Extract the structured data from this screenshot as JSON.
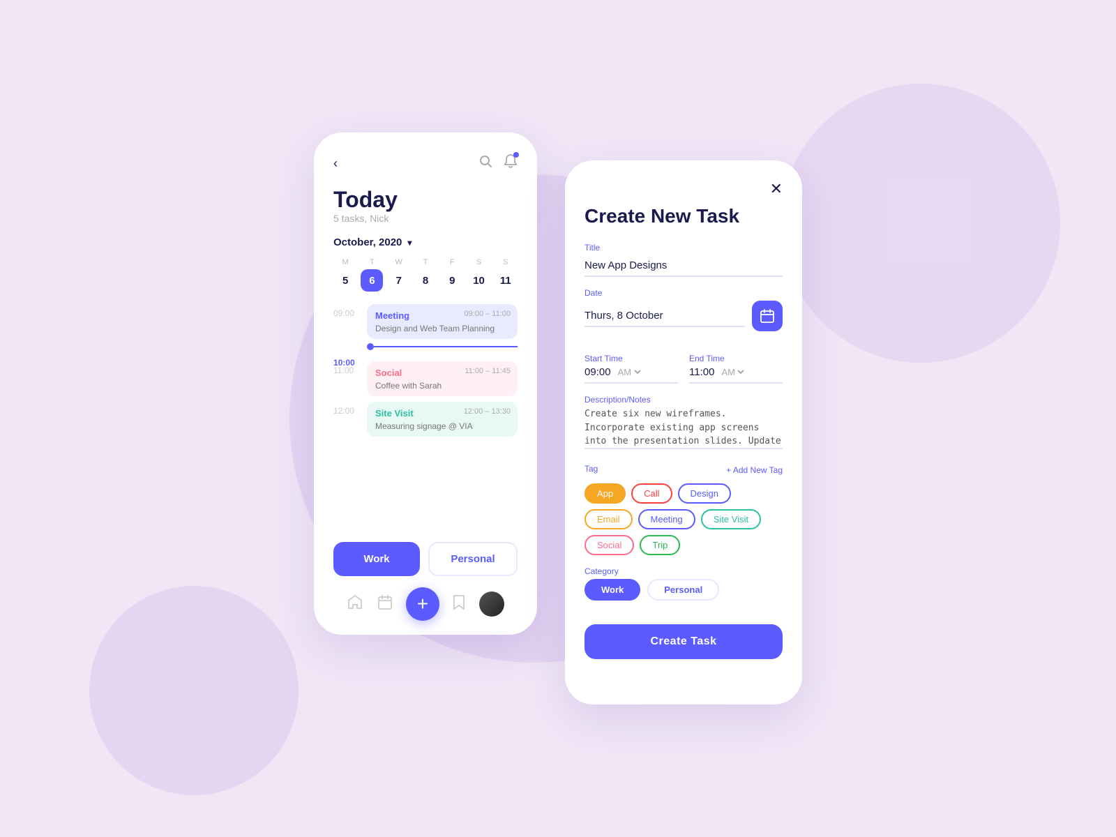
{
  "background": {
    "color": "#f0e6f6"
  },
  "phone1": {
    "header": {
      "back_label": "‹",
      "search_icon": "🔍",
      "notif_icon": "🔔"
    },
    "title": "Today",
    "subtitle": "5 tasks, Nick",
    "month": "October, 2020",
    "calendar": {
      "days": [
        {
          "letter": "M",
          "num": "5"
        },
        {
          "letter": "T",
          "num": "6",
          "active": true
        },
        {
          "letter": "W",
          "num": "7"
        },
        {
          "letter": "T",
          "num": "8"
        },
        {
          "letter": "F",
          "num": "9"
        },
        {
          "letter": "S",
          "num": "10"
        },
        {
          "letter": "S",
          "num": "11"
        }
      ]
    },
    "schedule": [
      {
        "time": "09:00",
        "event": {
          "title": "Meeting",
          "time_range": "09:00 – 11:00",
          "desc": "Design and Web Team Planning",
          "color": "blue"
        }
      },
      {
        "time": "10:00",
        "highlight": true
      },
      {
        "time": "11:00",
        "event": {
          "title": "Social",
          "time_range": "11:00 – 11:45",
          "desc": "Coffee with Sarah",
          "color": "pink"
        }
      },
      {
        "time": "12:00",
        "event": {
          "title": "Site Visit",
          "time_range": "12:00 – 13:30",
          "desc": "Measuring signage @ VIA",
          "color": "teal"
        }
      }
    ],
    "buttons": {
      "work": "Work",
      "personal": "Personal"
    },
    "nav": {
      "home_icon": "⌂",
      "calendar_icon": "📅",
      "add_icon": "+",
      "bookmark_icon": "🔖"
    }
  },
  "phone2": {
    "close_icon": "✕",
    "title": "Create New Task",
    "fields": {
      "title_label": "Title",
      "title_value": "New App Designs",
      "date_label": "Date",
      "date_value": "Thurs, 8 October",
      "start_time_label": "Start Time",
      "start_time_value": "09:00",
      "start_ampm": "AM",
      "end_time_label": "End Time",
      "end_time_value": "11:00",
      "end_ampm": "AM",
      "desc_label": "Description/Notes",
      "desc_value": "Create six new wireframes. Incorporate existing app screens into the presentation slides. Update and expand existing icons."
    },
    "tags": {
      "label": "Tag",
      "add_label": "+ Add New Tag",
      "items": [
        {
          "name": "App",
          "style": "app"
        },
        {
          "name": "Call",
          "style": "call"
        },
        {
          "name": "Design",
          "style": "design"
        },
        {
          "name": "Email",
          "style": "email"
        },
        {
          "name": "Meeting",
          "style": "meeting"
        },
        {
          "name": "Site Visit",
          "style": "sitevisit"
        },
        {
          "name": "Social",
          "style": "social"
        },
        {
          "name": "Trip",
          "style": "trip"
        }
      ]
    },
    "category": {
      "label": "Category",
      "items": [
        {
          "name": "Work",
          "style": "work"
        },
        {
          "name": "Personal",
          "style": "personal"
        }
      ]
    },
    "create_button": "Create Task"
  }
}
